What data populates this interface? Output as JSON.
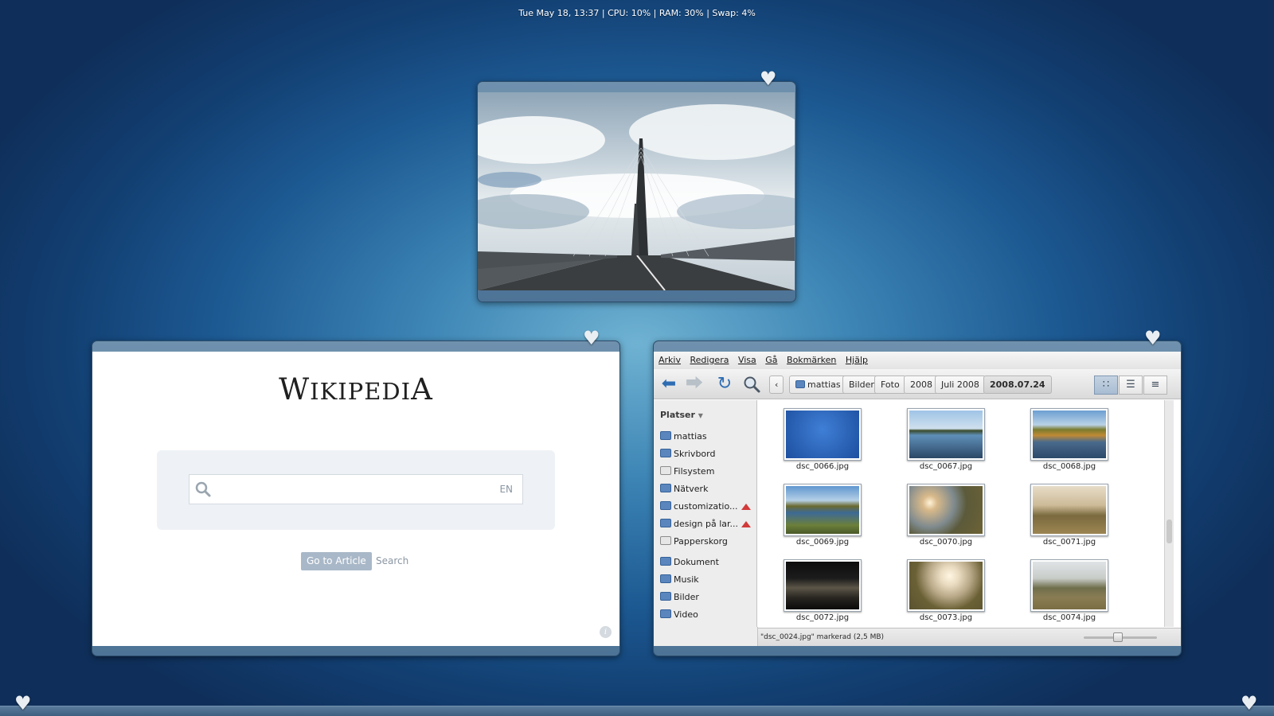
{
  "status_bar": {
    "text": "Tue May 18, 13:37 | CPU: 10% | RAM: 30% | Swap: 4%"
  },
  "icons": {
    "heart": "heart-icon",
    "info": "info-icon",
    "search": "search-icon"
  },
  "wikipedia": {
    "logo_first": "W",
    "logo_rest": "IKIPEDI",
    "logo_last": "A",
    "language": "EN",
    "go_button": "Go to Article",
    "search_button": "Search",
    "info": "i"
  },
  "file_manager": {
    "menu": [
      "Arkiv",
      "Redigera",
      "Visa",
      "Gå",
      "Bokmärken",
      "Hjälp"
    ],
    "breadcrumbs": [
      "mattias",
      "Bilder",
      "Foto",
      "2008",
      "Juli 2008",
      "2008.07.24"
    ],
    "sidebar_header": "Platser",
    "places": [
      "mattias",
      "Skrivbord",
      "Filsystem",
      "Nätverk",
      "customizatio...",
      "design på lar...",
      "Papperskorg"
    ],
    "bookmarks": [
      "Dokument",
      "Musik",
      "Bilder",
      "Video"
    ],
    "files": [
      "dsc_0066.jpg",
      "dsc_0067.jpg",
      "dsc_0068.jpg",
      "dsc_0069.jpg",
      "dsc_0070.jpg",
      "dsc_0071.jpg",
      "dsc_0072.jpg",
      "dsc_0073.jpg",
      "dsc_0074.jpg"
    ],
    "status": "\"dsc_0024.jpg\" markerad (2,5 MB)"
  },
  "colors": {
    "accent": "#4d7396",
    "desktop_center": "#6fb2d2",
    "desktop_edge": "#0f2f5a"
  }
}
